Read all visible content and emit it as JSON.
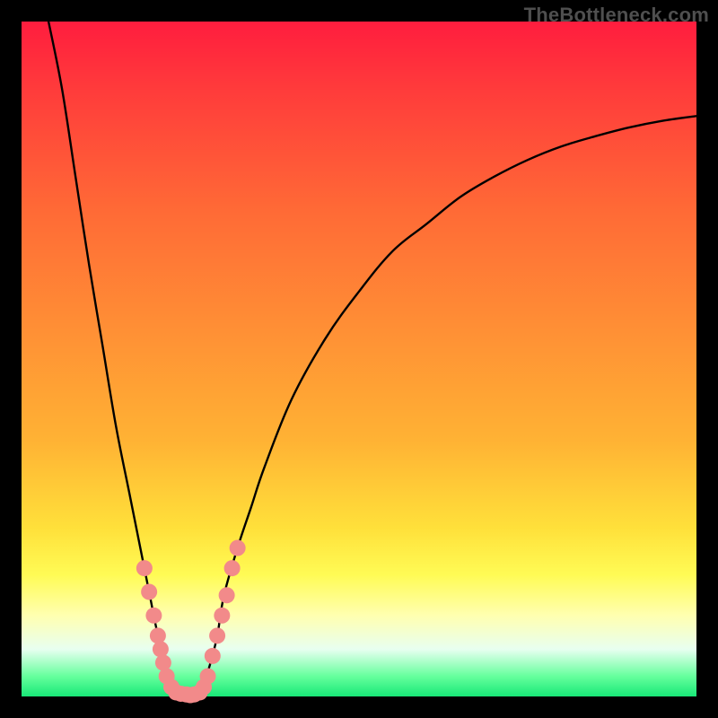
{
  "watermark": "TheBottleneck.com",
  "colors": {
    "frame": "#000000",
    "curve": "#000000",
    "marker": "#f28a8a",
    "grad_top": "#ff1d3e",
    "grad_bottom": "#18e877"
  },
  "chart_data": {
    "type": "line",
    "title": "",
    "xlabel": "",
    "ylabel": "",
    "ylim": [
      0,
      100
    ],
    "xlim": [
      0,
      100
    ],
    "series": [
      {
        "name": "left-branch",
        "x": [
          4,
          6,
          8,
          10,
          12,
          14,
          16,
          18,
          19,
          20,
          21,
          22,
          23,
          24,
          25
        ],
        "values": [
          100,
          90,
          77,
          64,
          52,
          40,
          30,
          20,
          15,
          10,
          6,
          3,
          1,
          0.3,
          0.2
        ]
      },
      {
        "name": "right-branch",
        "x": [
          25,
          26,
          27,
          28,
          29,
          30,
          32,
          34,
          36,
          40,
          45,
          50,
          55,
          60,
          65,
          70,
          75,
          80,
          85,
          90,
          95,
          100
        ],
        "values": [
          0.2,
          0.5,
          2,
          5,
          9,
          15,
          22,
          28,
          34,
          44,
          53,
          60,
          66,
          70,
          74,
          77,
          79.5,
          81.5,
          83,
          84.3,
          85.3,
          86
        ]
      }
    ],
    "markers": {
      "name": "highlight-points",
      "x": [
        18.2,
        18.9,
        19.6,
        20.2,
        20.6,
        21.0,
        21.5,
        22.2,
        22.9,
        23.6,
        24.4,
        25.0,
        25.6,
        26.4,
        27.0,
        27.6,
        28.3,
        29.0,
        29.7,
        30.4,
        31.2,
        32.0
      ],
      "values": [
        19,
        15.5,
        12,
        9,
        7,
        5,
        3,
        1.4,
        0.6,
        0.4,
        0.3,
        0.2,
        0.3,
        0.6,
        1.4,
        3,
        6,
        9,
        12,
        15,
        19,
        22
      ]
    }
  }
}
